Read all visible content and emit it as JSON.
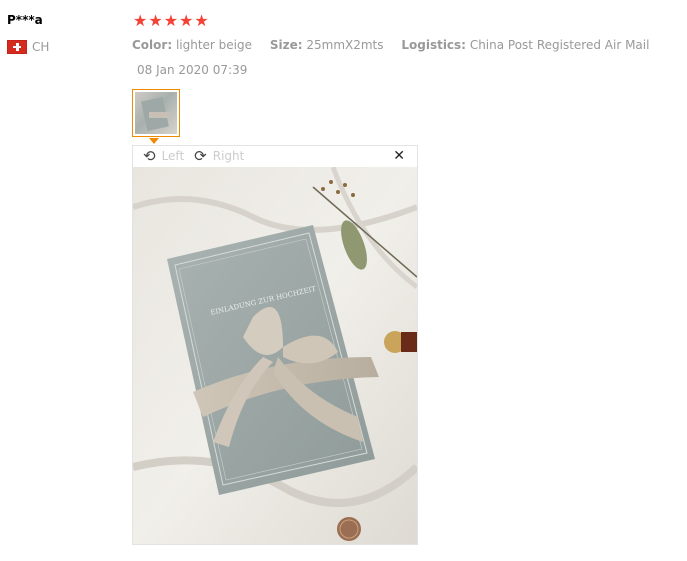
{
  "review": {
    "user_name": "P***a",
    "country_code": "CH",
    "rating": 5,
    "star_glyph": "★",
    "color_label": "Color:",
    "color_value": "lighter beige",
    "size_label": "Size:",
    "size_value": "25mmX2mts",
    "logistics_label": "Logistics:",
    "logistics_value": "China Post Registered Air Mail",
    "date": "08 Jan 2020 07:39"
  },
  "viewer": {
    "rotate_left_label": "Left",
    "rotate_right_label": "Right",
    "rotate_left_icon": "⟲",
    "rotate_right_icon": "⟳",
    "close_icon": "✕"
  },
  "colors": {
    "star": "#f44336",
    "thumb_border": "#f08a00",
    "muted_text": "#999999"
  }
}
